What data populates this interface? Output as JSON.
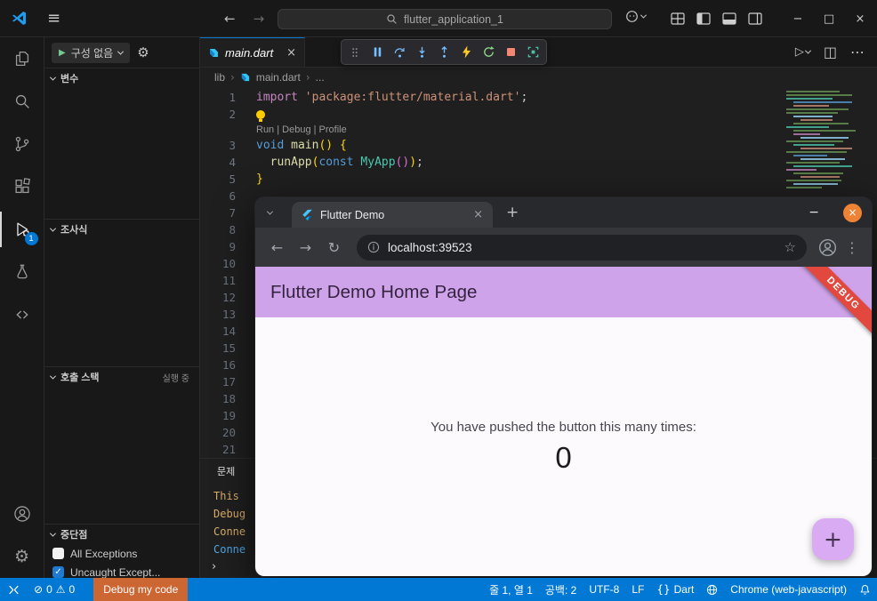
{
  "glyphs": {
    "menu": "≡",
    "back": "←",
    "forward": "→",
    "reload": "↻",
    "minimize": "−",
    "maximize": "□",
    "close": "×",
    "split_editor": "◫",
    "more": "⋯",
    "run": "▷",
    "star": "☆",
    "overflow": "⋮",
    "new_tab": "+",
    "gear": "⚙",
    "play": "▶",
    "check": "✓",
    "errors_icon": "⊘",
    "warnings_icon": "⚠",
    "braces": "{}",
    "crumb_sep": "›"
  },
  "titlebar": {
    "search": "flutter_application_1"
  },
  "activitybar": {
    "debug_badge": "1",
    "badge_color": "#0078d4"
  },
  "sidebar": {
    "run_button_label": "구성 없음",
    "variables_header": "변수",
    "watch_header": "조사식",
    "callstack_header": "호출 스택",
    "callstack_status": "실행 중",
    "breakpoints_header": "중단점",
    "breakpoints": [
      {
        "label": "All Exceptions",
        "checked": false
      },
      {
        "label": "Uncaught Except...",
        "checked": true
      }
    ]
  },
  "editor": {
    "tab_label": "main.dart",
    "breadcrumb": {
      "folder": "lib",
      "file": "main.dart",
      "more": "..."
    },
    "lines": [
      {
        "n": "1",
        "tokens": [
          {
            "t": "import",
            "c": "kw2"
          },
          {
            "t": " ",
            "c": "pln"
          },
          {
            "t": "'package:flutter/material.dart'",
            "c": "str"
          },
          {
            "t": ";",
            "c": "pln"
          }
        ]
      },
      {
        "n": "2",
        "bulb": true,
        "tokens": []
      },
      {
        "lens": "Run | Debug | Profile"
      },
      {
        "n": "3",
        "tokens": [
          {
            "t": "void",
            "c": "kw"
          },
          {
            "t": " ",
            "c": "pln"
          },
          {
            "t": "main",
            "c": "fn"
          },
          {
            "t": "()",
            "c": "br1"
          },
          {
            "t": " ",
            "c": "pln"
          },
          {
            "t": "{",
            "c": "br1"
          }
        ]
      },
      {
        "n": "4",
        "tokens": [
          {
            "t": "  ",
            "c": "pln"
          },
          {
            "t": "runApp",
            "c": "fn"
          },
          {
            "t": "(",
            "c": "br1"
          },
          {
            "t": "const",
            "c": "kw"
          },
          {
            "t": " ",
            "c": "pln"
          },
          {
            "t": "MyApp",
            "c": "type"
          },
          {
            "t": "()",
            "c": "br2"
          },
          {
            "t": ")",
            "c": "br1"
          },
          {
            "t": ";",
            "c": "pln"
          }
        ]
      },
      {
        "n": "5",
        "tokens": [
          {
            "t": "}",
            "c": "br1"
          }
        ]
      },
      {
        "n": "6"
      },
      {
        "n": "7"
      },
      {
        "n": "8"
      },
      {
        "n": "9"
      },
      {
        "n": "10"
      },
      {
        "n": "11"
      },
      {
        "n": "12"
      },
      {
        "n": "13"
      },
      {
        "n": "14"
      },
      {
        "n": "15"
      },
      {
        "n": "16"
      },
      {
        "n": "17"
      },
      {
        "n": "18"
      },
      {
        "n": "19"
      },
      {
        "n": "20"
      },
      {
        "n": "21"
      }
    ]
  },
  "panel": {
    "problems_tab": "문제",
    "console_lines": [
      {
        "text": "This ",
        "color": "#dcae67"
      },
      {
        "text": "Debug",
        "color": "#dcae67"
      },
      {
        "text": "Conne",
        "color": "#dcae67"
      },
      {
        "text": "Conne",
        "color": "#4fa8e8"
      }
    ],
    "prompt": "›"
  },
  "browser": {
    "tab_title": "Flutter Demo",
    "url": "localhost:39523",
    "close_button_color": "#ee8336",
    "page": {
      "appbar_title": "Flutter Demo Home Page",
      "debug_banner": "DEBUG",
      "body_text": "You have pushed the button this many times:",
      "counter": "0",
      "appbar_color": "#cfa3e9",
      "fab_color": "#d9abf2",
      "banner_color": "#e2483d"
    }
  },
  "statusbar": {
    "bar_color": "#0078d4",
    "debug_item_color": "#cc6633",
    "errors": "0",
    "warnings": "0",
    "debug_config": "Debug my code",
    "line_col": "줄 1, 열 1",
    "indent": "공백: 2",
    "encoding": "UTF-8",
    "eol": "LF",
    "language": "Dart",
    "runtime": "Chrome (web-javascript)"
  }
}
